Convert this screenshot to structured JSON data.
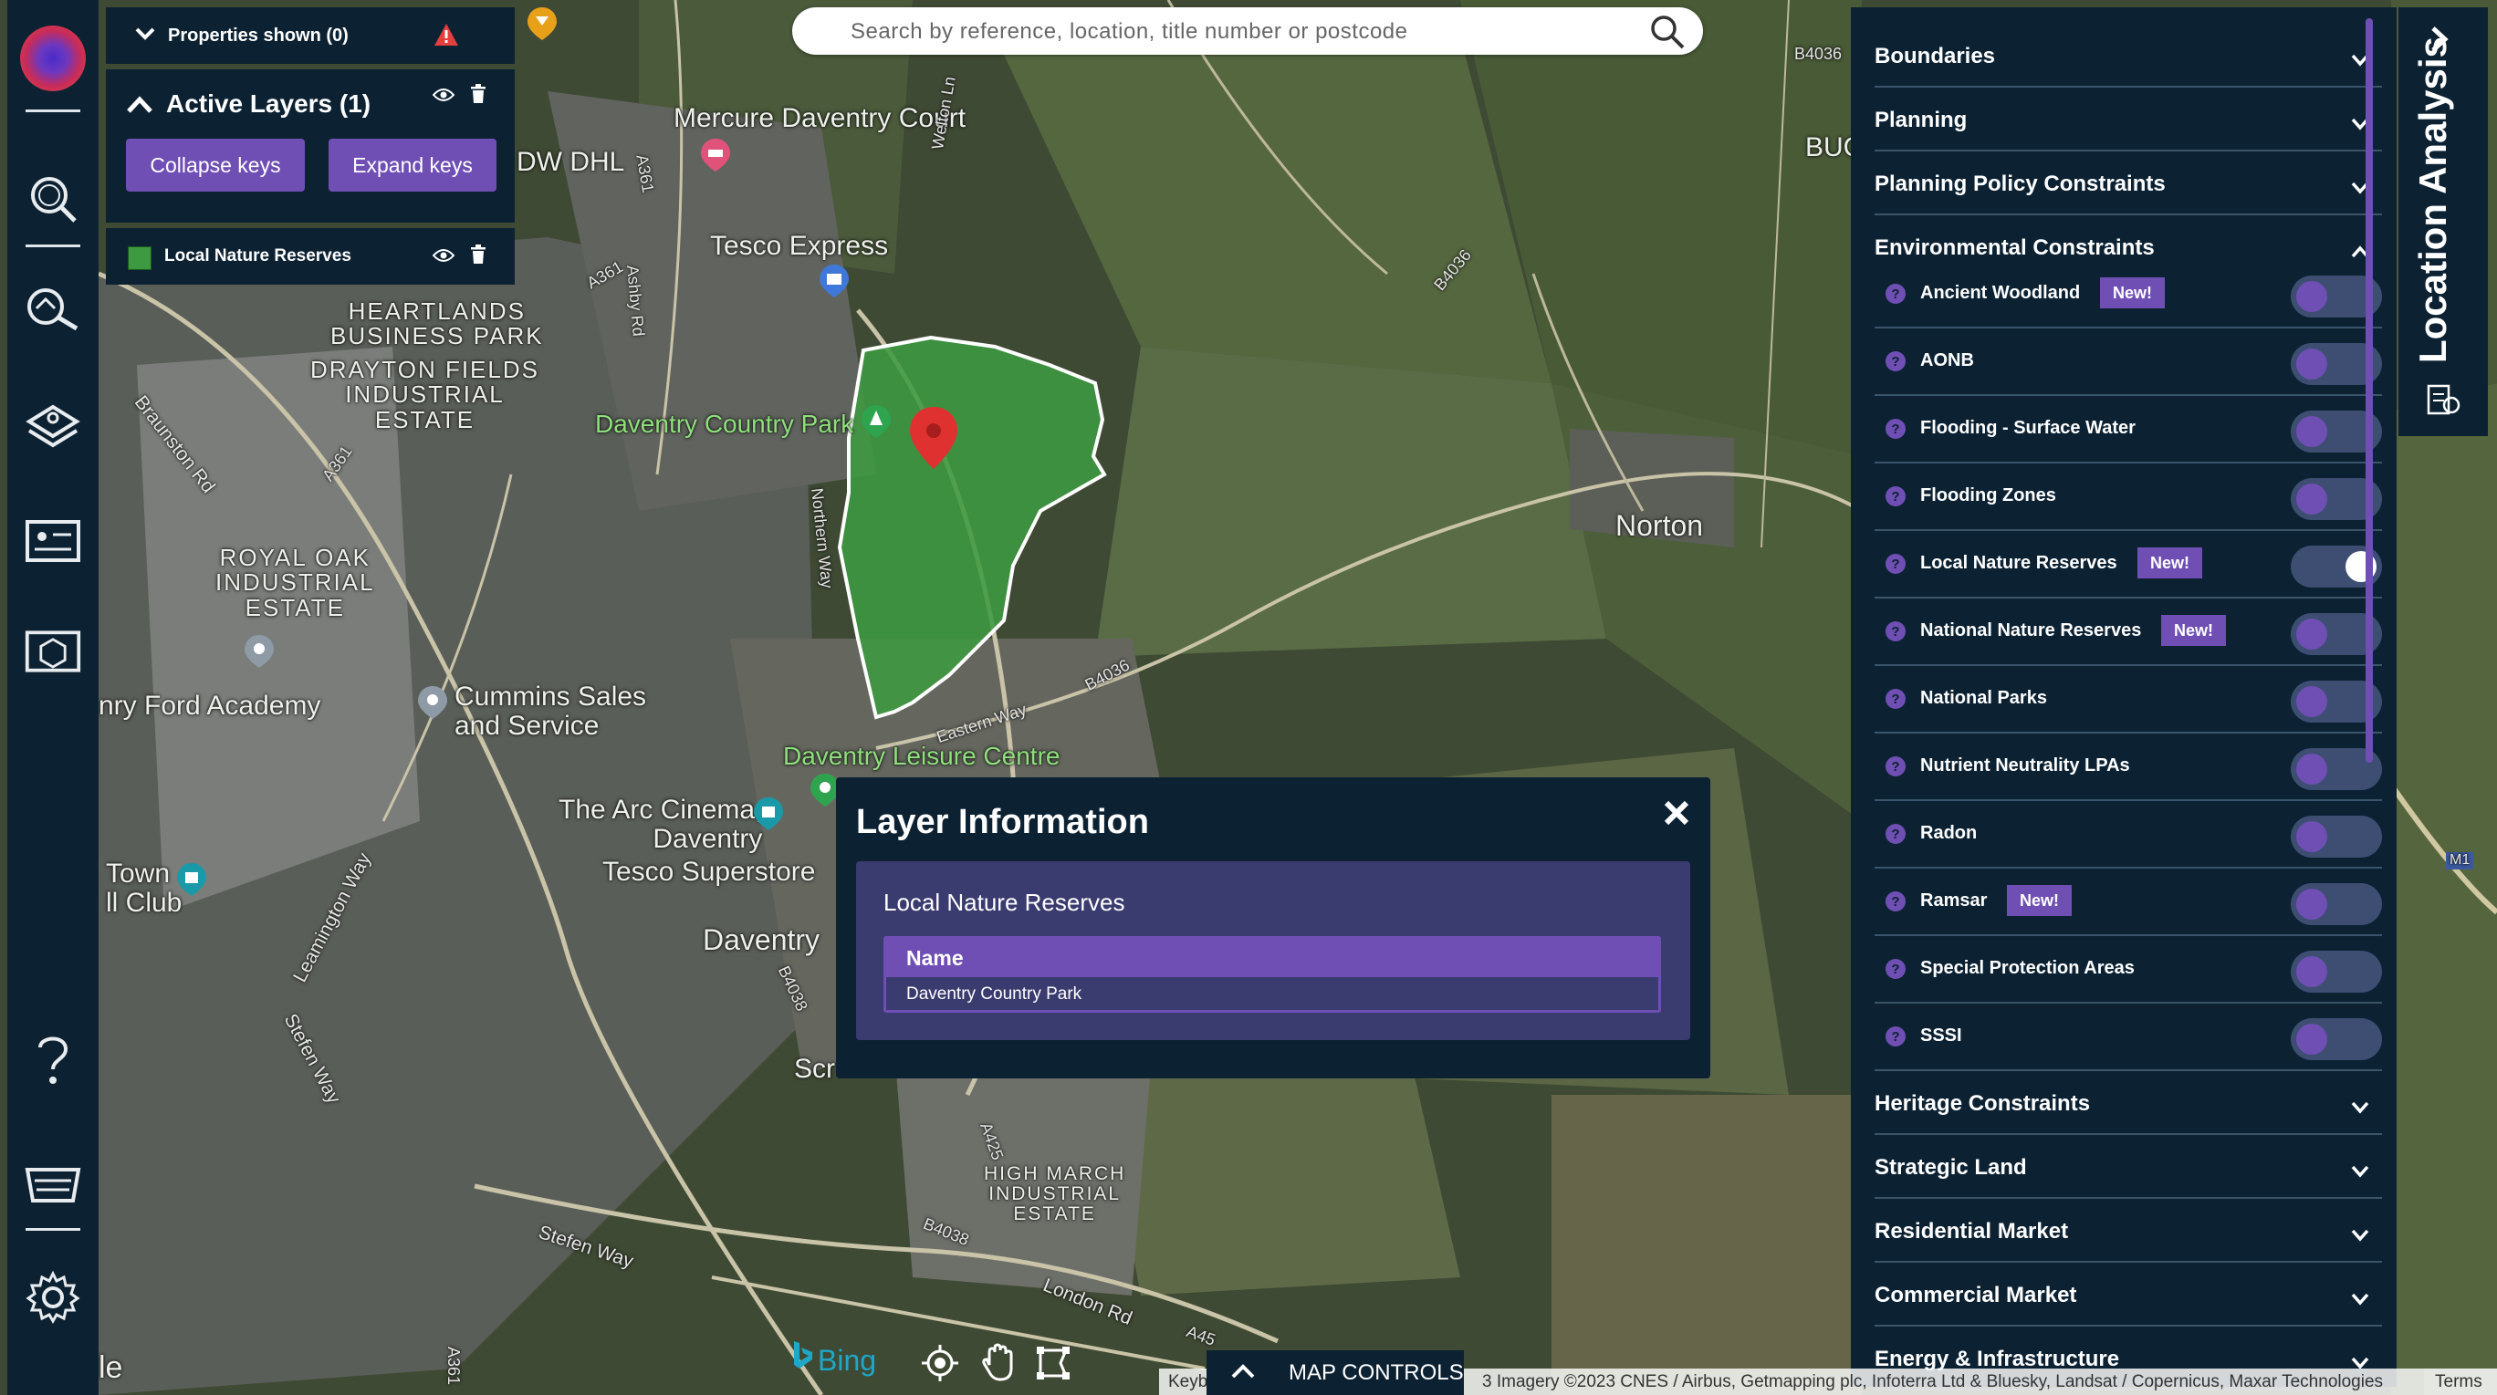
{
  "search": {
    "placeholder": "Search by reference, location, title number or postcode"
  },
  "properties_bar": {
    "label": "Properties shown (0)"
  },
  "active_layers": {
    "title": "Active Layers (1)",
    "collapse_label": "Collapse keys",
    "expand_label": "Expand keys",
    "layers": [
      {
        "name": "Local Nature Reserves",
        "color": "#3e9a41"
      }
    ]
  },
  "right_panel": {
    "sections_top": [
      "Boundaries",
      "Planning",
      "Planning Policy Constraints"
    ],
    "env_title": "Environmental Constraints",
    "env_items": [
      {
        "label": "Ancient Woodland",
        "new": true,
        "on": false
      },
      {
        "label": "AONB",
        "new": false,
        "on": false
      },
      {
        "label": "Flooding - Surface Water",
        "new": false,
        "on": false
      },
      {
        "label": "Flooding Zones",
        "new": false,
        "on": false
      },
      {
        "label": "Local Nature Reserves",
        "new": true,
        "on": true
      },
      {
        "label": "National Nature Reserves",
        "new": true,
        "on": false
      },
      {
        "label": "National Parks",
        "new": false,
        "on": false
      },
      {
        "label": "Nutrient Neutrality LPAs",
        "new": false,
        "on": false
      },
      {
        "label": "Radon",
        "new": false,
        "on": false
      },
      {
        "label": "Ramsar",
        "new": true,
        "on": false
      },
      {
        "label": "Special Protection Areas",
        "new": false,
        "on": false
      },
      {
        "label": "SSSI",
        "new": false,
        "on": false
      }
    ],
    "new_badge": "New!",
    "help_glyph": "?",
    "sections_bottom": [
      "Heritage Constraints",
      "Strategic Land",
      "Residential Market",
      "Commercial Market",
      "Energy & Infrastructure"
    ]
  },
  "location_tab": {
    "label": "Location Analysis"
  },
  "popup": {
    "title": "Layer Information",
    "layer": "Local Nature Reserves",
    "column": "Name",
    "value": "Daventry Country Park"
  },
  "map": {
    "labels": {
      "mercure": "Mercure Daventry Court",
      "dwdhl": "DW DHL",
      "tesco_express": "Tesco Express",
      "heartlands": "HEARTLANDS\nBUSINESS PARK",
      "drayton": "DRAYTON FIELDS\nINDUSTRIAL\nESTATE",
      "country_park": "Daventry Country Park",
      "royal_oak": "ROYAL OAK\nINDUSTRIAL\nESTATE",
      "ford_academy": "nry Ford Academy",
      "cummins": "Cummins Sales\nand Service",
      "leisure": "Daventry Leisure Centre",
      "arc": "The Arc Cinema,\nDaventry",
      "tesco_super": "Tesco Superstore",
      "daventry": "Daventry",
      "town_club": "Town\nll Club",
      "norton": "Norton",
      "buc": "BUC",
      "high_march": "HIGH MARCH\nINDUSTRIAL\nESTATE",
      "scr": "Scr",
      "le": "le",
      "braunston": "Braunston Rd",
      "ashby": "Ashby Rd",
      "northern_way": "Northern Way",
      "eastern_way": "Eastern Way",
      "b4036a": "B4036",
      "b4036b": "B4036",
      "b4036c": "B4036",
      "a361a": "A361",
      "a361b": "A361",
      "a361c": "A361",
      "a361d": "A361",
      "leamington": "Leamington Way",
      "stefen": "Stefen Way",
      "stefen2": "Stefen Way",
      "london_rd": "London Rd",
      "b4038": "B4038",
      "b4038b": "B4038",
      "a425": "A425",
      "a45": "A45",
      "welton": "Welton Ln",
      "m1": "M1"
    },
    "attribution": {
      "keyb": "Keyb",
      "imagery": "3 Imagery ©2023 CNES / Airbus, Getmapping plc, Infoterra Ltd & Bluesky, Landsat / Copernicus, Maxar Technologies"
    },
    "terms": "Terms"
  },
  "bottom": {
    "bing": "Bing",
    "map_controls": "MAP CONTROLS"
  },
  "colors": {
    "panel": "#0c2233",
    "accent": "#6f4fb4",
    "reserve_fill": "#3e9a41",
    "marker": "#e03131"
  },
  "icons": [
    "search-icon",
    "property-search-icon",
    "layers-icon",
    "report-icon",
    "package-icon",
    "help-icon",
    "basket-icon",
    "settings-icon",
    "eye-icon",
    "trash-icon",
    "warning-icon",
    "location-pin-icon",
    "crosshair-icon",
    "hand-icon",
    "draw-icon",
    "close-icon",
    "chevron-down-icon",
    "chevron-up-icon",
    "chevron-right-icon"
  ]
}
